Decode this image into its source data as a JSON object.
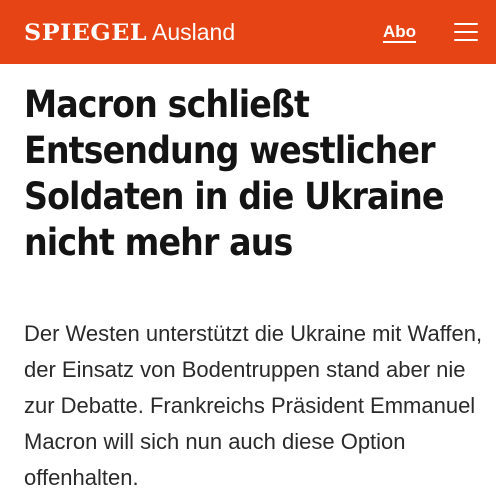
{
  "header": {
    "logo_text": "SPIEGEL",
    "section_label": "Ausland",
    "abo_label": "Abo",
    "menu_icon": "hamburger-menu-icon",
    "background_color": "#e64415"
  },
  "article": {
    "headline": "Macron schließt Entsendung westlicher Soldaten in die Ukraine nicht mehr aus",
    "teaser": "Der Westen unterstützt die Ukraine mit Waffen, der Einsatz von Bodentruppen stand aber nie zur Debatte. Frankreichs Präsident Emmanuel Macron will sich nun auch diese Option offenhalten."
  }
}
